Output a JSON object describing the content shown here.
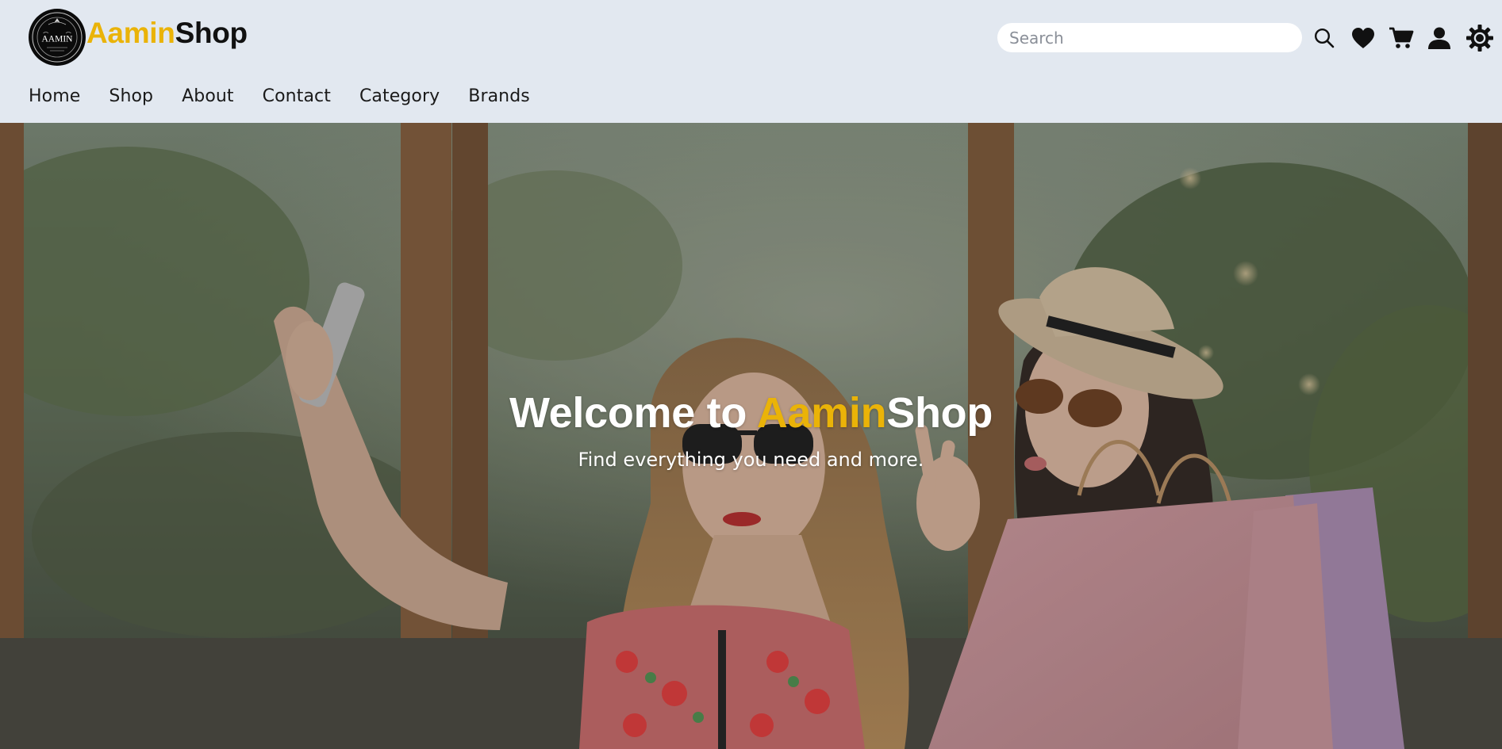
{
  "brand": {
    "logo_badge_text": "AAMIN",
    "name_accent": "Aamin",
    "name_rest": "Shop",
    "accent_color": "#eab308"
  },
  "search": {
    "placeholder": "Search",
    "value": ""
  },
  "header_icons": [
    "search-icon",
    "heart-icon",
    "cart-icon",
    "user-icon",
    "gear-icon"
  ],
  "nav": {
    "items": [
      {
        "label": "Home"
      },
      {
        "label": "Shop"
      },
      {
        "label": "About"
      },
      {
        "label": "Contact"
      },
      {
        "label": "Category"
      },
      {
        "label": "Brands"
      }
    ]
  },
  "hero": {
    "title_prefix": "Welcome to ",
    "title_accent": "Aamin",
    "title_rest": "Shop",
    "subtitle": "Find everything you need and more."
  },
  "colors": {
    "header_bg": "#e2e8f0",
    "accent": "#eab308",
    "text_dark": "#111111"
  }
}
